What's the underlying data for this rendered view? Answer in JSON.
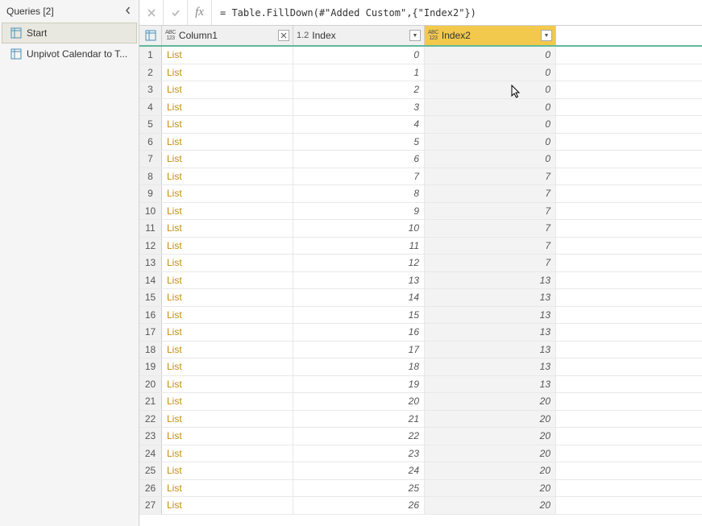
{
  "queries_panel": {
    "title": "Queries [2]",
    "items": [
      {
        "label": "Start",
        "active": true
      },
      {
        "label": "Unpivot Calendar to T...",
        "active": false
      }
    ]
  },
  "formula_bar": {
    "value": "= Table.FillDown(#\"Added Custom\",{\"Index2\"})"
  },
  "columns": [
    {
      "name": "Column1",
      "type": "any"
    },
    {
      "name": "Index",
      "type": "decimal"
    },
    {
      "name": "Index2",
      "type": "any",
      "selected": true
    }
  ],
  "chart_data": {
    "type": "table",
    "columns": [
      "#",
      "Column1",
      "Index",
      "Index2"
    ],
    "rows": [
      [
        1,
        "List",
        0,
        0
      ],
      [
        2,
        "List",
        1,
        0
      ],
      [
        3,
        "List",
        2,
        0
      ],
      [
        4,
        "List",
        3,
        0
      ],
      [
        5,
        "List",
        4,
        0
      ],
      [
        6,
        "List",
        5,
        0
      ],
      [
        7,
        "List",
        6,
        0
      ],
      [
        8,
        "List",
        7,
        7
      ],
      [
        9,
        "List",
        8,
        7
      ],
      [
        10,
        "List",
        9,
        7
      ],
      [
        11,
        "List",
        10,
        7
      ],
      [
        12,
        "List",
        11,
        7
      ],
      [
        13,
        "List",
        12,
        7
      ],
      [
        14,
        "List",
        13,
        13
      ],
      [
        15,
        "List",
        14,
        13
      ],
      [
        16,
        "List",
        15,
        13
      ],
      [
        17,
        "List",
        16,
        13
      ],
      [
        18,
        "List",
        17,
        13
      ],
      [
        19,
        "List",
        18,
        13
      ],
      [
        20,
        "List",
        19,
        13
      ],
      [
        21,
        "List",
        20,
        20
      ],
      [
        22,
        "List",
        21,
        20
      ],
      [
        23,
        "List",
        22,
        20
      ],
      [
        24,
        "List",
        23,
        20
      ],
      [
        25,
        "List",
        24,
        20
      ],
      [
        26,
        "List",
        25,
        20
      ],
      [
        27,
        "List",
        26,
        20
      ]
    ]
  }
}
